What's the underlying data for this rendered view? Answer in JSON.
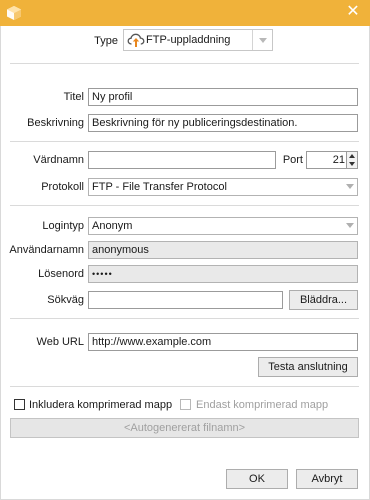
{
  "window": {
    "close_icon": "close-icon",
    "app_icon": "box-icon"
  },
  "type": {
    "label": "Type",
    "value": "FTP-uppladdning",
    "icon": "cloud-upload-icon"
  },
  "titel": {
    "label": "Titel",
    "value": "Ny profil"
  },
  "beskrivning": {
    "label": "Beskrivning",
    "value": "Beskrivning för ny publiceringsdestination."
  },
  "vardnamn": {
    "label": "Värdnamn",
    "value": ""
  },
  "port": {
    "label": "Port",
    "value": "21"
  },
  "protokoll": {
    "label": "Protokoll",
    "value": "FTP - File Transfer Protocol"
  },
  "logintyp": {
    "label": "Logintyp",
    "value": "Anonym"
  },
  "anvandarnamn": {
    "label": "Användarnamn",
    "value": "anonymous"
  },
  "losenord": {
    "label": "Lösenord",
    "value": "•••••"
  },
  "sokvag": {
    "label": "Sökväg",
    "value": "",
    "browse_label": "Bläddra..."
  },
  "weburl": {
    "label": "Web URL",
    "value": "http://www.example.com"
  },
  "test_button": "Testa anslutning",
  "include_compressed": {
    "label": "Inkludera komprimerad mapp",
    "checked": false
  },
  "only_compressed": {
    "label": "Endast komprimerad mapp",
    "checked": false
  },
  "autogen_filename": "<Autogenererat filnamn>",
  "ok_button": "OK",
  "cancel_button": "Avbryt",
  "colors": {
    "titlebar": "#f0b23a",
    "accent_icon": "#e8861c"
  }
}
